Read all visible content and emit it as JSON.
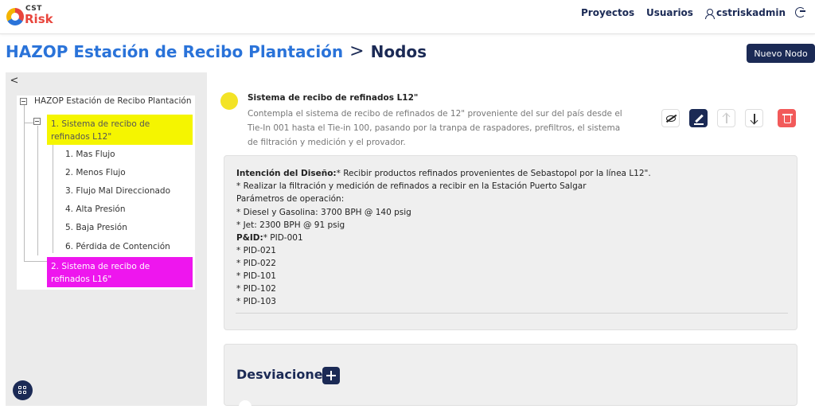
{
  "logo": {
    "top": "CST",
    "bottom": "Risk"
  },
  "nav": {
    "proyectos": "Proyectos",
    "usuarios": "Usuarios",
    "user": "cstriskadmin"
  },
  "header": {
    "project": "HAZOP Estación de Recibo Plantación",
    "separator": ">",
    "section": "Nodos",
    "new_node_label": "Nuevo Nodo"
  },
  "sidebar": {
    "collapse_glyph": "<",
    "root": "HAZOP Estación de Recibo Plantación",
    "nodes": [
      {
        "label": "1. Sistema de recibo de refinados L12\"",
        "color": "#f5f500"
      },
      {
        "label": "2. Sistema de recibo de refinados L16\"",
        "color": "#ee16ee"
      }
    ],
    "deviations": [
      "1. Mas Flujo",
      "2. Menos Flujo",
      "3. Flujo Mal Direccionado",
      "4. Alta Presión",
      "5. Baja Presión",
      "6. Pérdida de Contención"
    ]
  },
  "node": {
    "badge": "",
    "title": "Sistema de recibo de refinados L12\"",
    "description": "Contempla el sistema de recibo de refinados de 12\" proveniente del sur del país desde el Tie-In 001 hasta el Tie-in 100, pasando por la tranpa de raspadores, prefiltros, el sistema de filtración y medición y el provador."
  },
  "intent": {
    "label": "Intención del Diseño:",
    "first_text": "* Recibir productos refinados provenientes de Sebastopol por la línea L12\".",
    "lines": [
      "* Realizar la filtración y medición de refinados a recibir en la Estación Puerto Salgar",
      "Parámetros de operación:",
      "* Diesel y Gasolina: 3700 BPH @ 140 psig",
      "* Jet: 2300 BPH @ 91 psig"
    ],
    "pid_label": "P&ID:",
    "pid_first": "* PID-001",
    "pids": [
      "* PID-021",
      "* PID-022",
      "* PID-101",
      "* PID-102",
      "* PID-103"
    ]
  },
  "deviations_section": {
    "title": "Desviaciones"
  },
  "colors": {
    "primary": "#1b2a55",
    "accent": "#2a73d9",
    "danger": "#f25a5a"
  }
}
